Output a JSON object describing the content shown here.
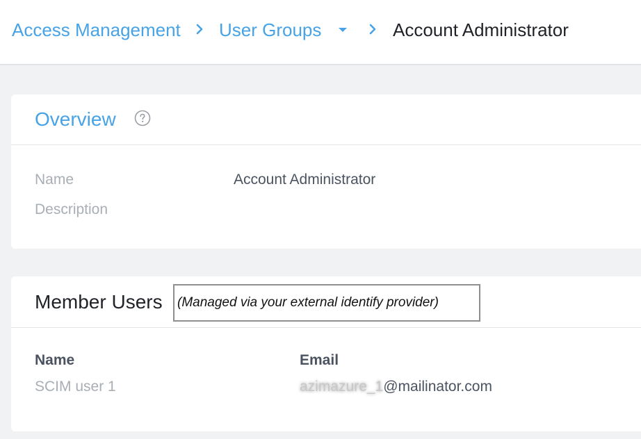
{
  "breadcrumb": {
    "items": [
      {
        "label": "Access Management"
      },
      {
        "label": "User Groups"
      },
      {
        "label": "Account Administrator"
      }
    ]
  },
  "overview": {
    "title": "Overview",
    "fields": [
      {
        "label": "Name",
        "value": "Account Administrator"
      },
      {
        "label": "Description",
        "value": ""
      }
    ]
  },
  "members": {
    "title": "Member Users",
    "note": "(Managed via your external identify provider)",
    "columns": [
      "Name",
      "Email"
    ],
    "rows": [
      {
        "name": "SCIM user 1",
        "email_redacted": "azimazure_1",
        "email_domain": "@mailinator.com"
      }
    ]
  },
  "colors": {
    "accent": "#47a3e6",
    "page_bg": "#f1f2f4",
    "muted_text": "#a9aeb5",
    "body_text": "#4b5360"
  },
  "icons": {
    "breadcrumb_separator": "chevron-right-icon",
    "dropdown": "caret-down-icon",
    "help": "help-circle-icon"
  }
}
